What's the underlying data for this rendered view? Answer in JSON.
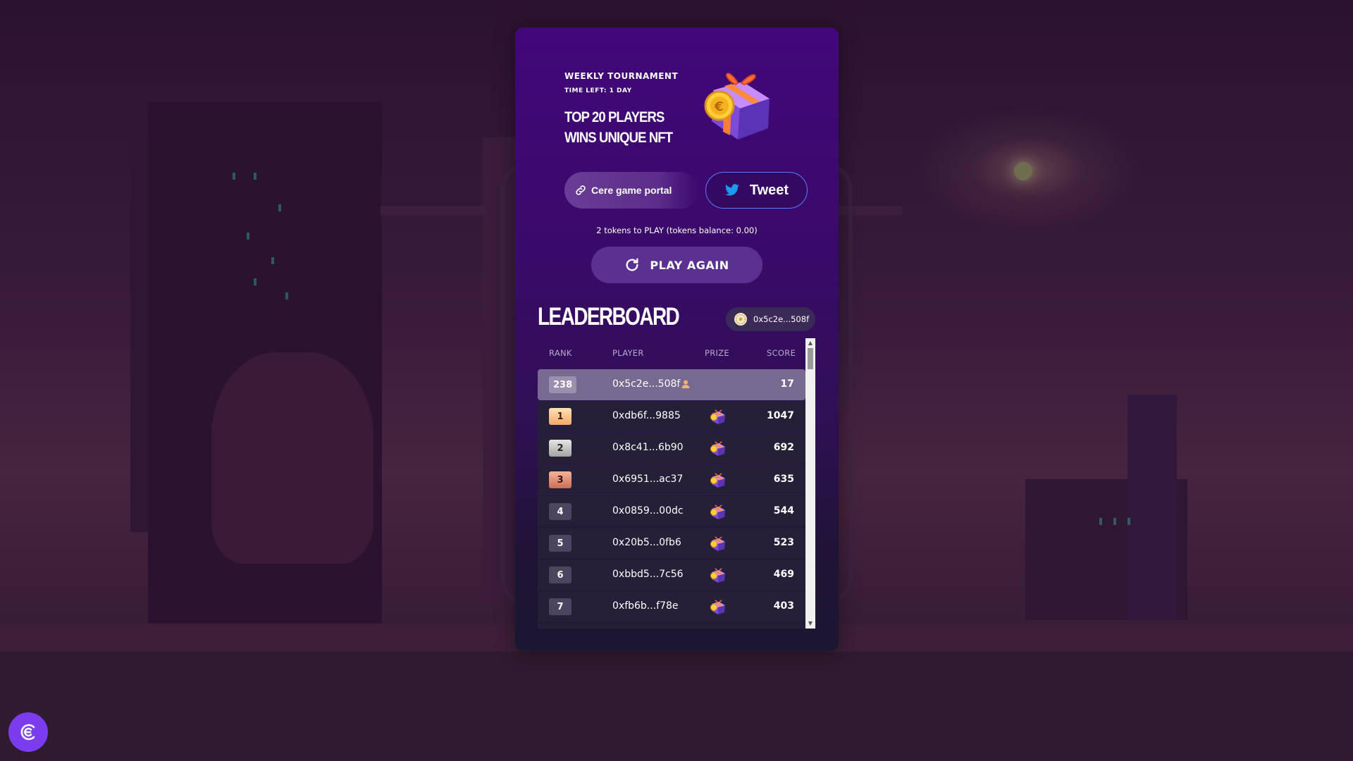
{
  "tournament": {
    "title": "WEEKLY TOURNAMENT",
    "time_left": "TIME LEFT: 1 DAY",
    "headline": "TOP 20 PLAYERS WINS UNIQUE NFT"
  },
  "actions": {
    "portal_label": "Cere game portal",
    "tweet_label": "Tweet",
    "tokens_text": "2 tokens to PLAY (tokens balance: 0.00)",
    "play_again_label": "PLAY AGAIN"
  },
  "leaderboard": {
    "title": "LEADERBOARD",
    "wallet": "0x5c2e...508f",
    "columns": {
      "rank": "RANK",
      "player": "PLAYER",
      "prize": "PRIZE",
      "score": "SCORE"
    },
    "current_user": {
      "rank": "238",
      "player": "0x5c2e...508f",
      "score": "17"
    },
    "rows": [
      {
        "rank": "1",
        "player": "0xdb6f...9885",
        "score": "1047"
      },
      {
        "rank": "2",
        "player": "0x8c41...6b90",
        "score": "692"
      },
      {
        "rank": "3",
        "player": "0x6951...ac37",
        "score": "635"
      },
      {
        "rank": "4",
        "player": "0x0859...00dc",
        "score": "544"
      },
      {
        "rank": "5",
        "player": "0x20b5...0fb6",
        "score": "523"
      },
      {
        "rank": "6",
        "player": "0xbbd5...7c56",
        "score": "469"
      },
      {
        "rank": "7",
        "player": "0xfb6b...f78e",
        "score": "403"
      }
    ]
  },
  "colors": {
    "accent": "#7b3cf0",
    "tweet_border": "#5b7cff",
    "twitter_blue": "#1d9bf0",
    "card_top": "#42077a"
  },
  "icons": {
    "portal": "link-icon",
    "tweet": "twitter-bird-icon",
    "play_again": "refresh-icon",
    "wallet": "coin-icon",
    "prize": "gift-box-icon",
    "current_user": "user-icon",
    "brand": "cere-logo-icon"
  }
}
